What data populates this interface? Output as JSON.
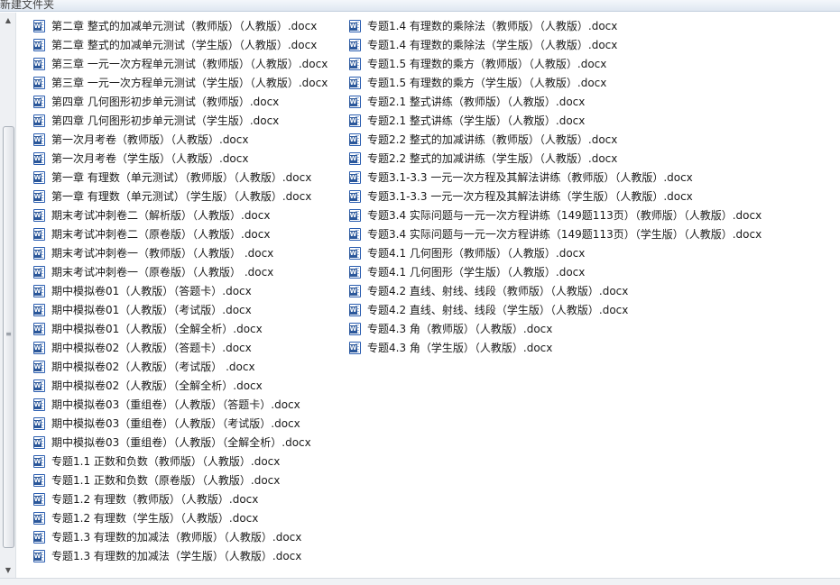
{
  "header": {
    "title_partial": "新建文件夹"
  },
  "icon": {
    "name": "word-docx-icon",
    "color": "#2b579a"
  },
  "files_left": [
    "第二章 整式的加减单元测试（教师版）（人教版）.docx",
    "第二章 整式的加减单元测试（学生版）（人教版）.docx",
    "第三章 一元一次方程单元测试（教师版）（人教版）.docx",
    "第三章 一元一次方程单元测试（学生版）（人教版）.docx",
    "第四章 几何图形初步单元测试（教师版）.docx",
    "第四章 几何图形初步单元测试（学生版）.docx",
    "第一次月考卷（教师版）（人教版）.docx",
    "第一次月考卷（学生版）（人教版）.docx",
    "第一章 有理数（单元测试）（教师版）（人教版）.docx",
    "第一章 有理数（单元测试）（学生版）（人教版）.docx",
    "期末考试冲刺卷二（解析版）（人教版）.docx",
    "期末考试冲刺卷二（原卷版）（人教版）.docx",
    "期末考试冲刺卷一（教师版）（人教版） .docx",
    "期末考试冲刺卷一（原卷版）（人教版） .docx",
    "期中模拟卷01（人教版）（答题卡）.docx",
    "期中模拟卷01（人教版）（考试版）.docx",
    "期中模拟卷01（人教版）（全解全析）.docx",
    "期中模拟卷02（人教版）（答题卡）.docx",
    "期中模拟卷02（人教版）（考试版） .docx",
    "期中模拟卷02（人教版）（全解全析）.docx",
    "期中模拟卷03（重组卷）（人教版）（答题卡）.docx",
    "期中模拟卷03（重组卷）（人教版）（考试版）.docx",
    "期中模拟卷03（重组卷）（人教版）（全解全析）.docx",
    "专题1.1 正数和负数（教师版）（人教版）.docx",
    "专题1.1 正数和负数（原卷版）（人教版）.docx",
    "专题1.2 有理数（教师版）（人教版）.docx",
    "专题1.2 有理数（学生版）（人教版）.docx",
    "专题1.3 有理数的加减法（教师版）（人教版）.docx",
    "专题1.3 有理数的加减法（学生版）（人教版）.docx"
  ],
  "files_right": [
    "专题1.4 有理数的乘除法（教师版）（人教版）.docx",
    "专题1.4 有理数的乘除法（学生版）（人教版）.docx",
    "专题1.5 有理数的乘方（教师版）（人教版）.docx",
    "专题1.5 有理数的乘方（学生版）（人教版）.docx",
    "专题2.1 整式讲练（教师版）（人教版）.docx",
    "专题2.1 整式讲练（学生版）（人教版）.docx",
    "专题2.2 整式的加减讲练（教师版）（人教版）.docx",
    "专题2.2 整式的加减讲练（学生版）（人教版）.docx",
    "专题3.1-3.3 一元一次方程及其解法讲练（教师版）（人教版）.docx",
    "专题3.1-3.3 一元一次方程及其解法讲练（学生版）（人教版）.docx",
    "专题3.4 实际问题与一元一次方程讲练（149题113页）（教师版）（人教版）.docx",
    "专题3.4 实际问题与一元一次方程讲练（149题113页）（学生版）（人教版）.docx",
    "专题4.1 几何图形（教师版）（人教版）.docx",
    "专题4.1 几何图形（学生版）（人教版）.docx",
    "专题4.2 直线、射线、线段（教师版）（人教版）.docx",
    "专题4.2 直线、射线、线段（学生版）（人教版）.docx",
    "专题4.3 角（教师版）（人教版）.docx",
    "专题4.3 角（学生版）（人教版）.docx"
  ]
}
